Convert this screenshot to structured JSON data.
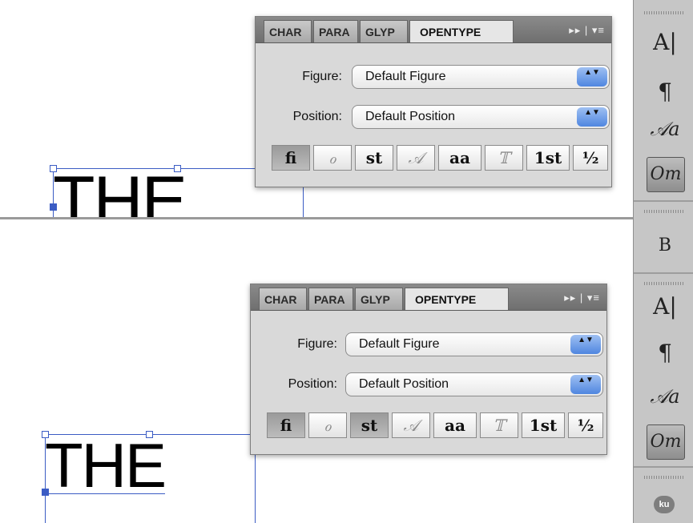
{
  "canvas_text": "THE",
  "panel": {
    "tabs": [
      "CHAR",
      "PARA",
      "GLYP",
      "OPENTYPE"
    ],
    "active_tab": "OPENTYPE",
    "menu_glyphs": "▸▸ | ▾≡",
    "figure_label": "Figure:",
    "figure_value": "Default Figure",
    "position_label": "Position:",
    "position_value": "Default Position",
    "select_arrow": "▲▼",
    "glyph_buttons": [
      "fi",
      "ℴ",
      "st",
      "𝒜",
      "aa",
      "𝕋",
      "1st",
      "½"
    ]
  },
  "dock": {
    "icons": [
      "A|",
      "¶",
      "𝒜a",
      "Oт"
    ],
    "kuler_label": "ku",
    "top_extra_icon": "B"
  },
  "colors": {
    "selection": "#3b5cc4",
    "select_arrow": "#4f86e0"
  }
}
